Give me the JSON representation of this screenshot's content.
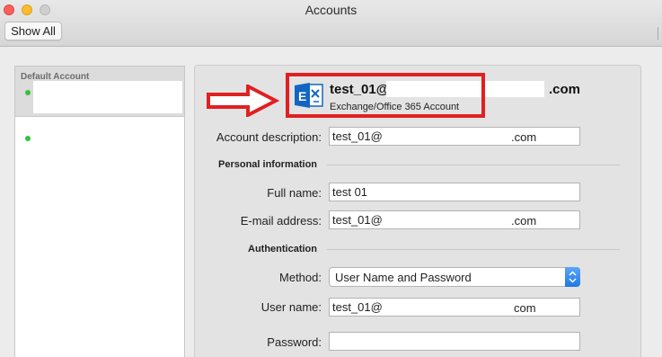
{
  "window": {
    "title": "Accounts",
    "show_all_label": "Show All"
  },
  "sidebar": {
    "default_label": "Default Account"
  },
  "account": {
    "name_prefix": "test_01@",
    "name_suffix": ".com",
    "type": "Exchange/Office 365 Account",
    "icon": "exchange-icon"
  },
  "form": {
    "description_label": "Account description:",
    "description_prefix": "test_01@",
    "description_suffix": ".com",
    "personal_section": "Personal information",
    "fullname_label": "Full name:",
    "fullname_value": "test 01",
    "email_label": "E-mail address:",
    "email_prefix": "test_01@",
    "email_suffix": ".com",
    "auth_section": "Authentication",
    "method_label": "Method:",
    "method_value": "User Name and Password",
    "username_label": "User name:",
    "username_prefix": "test_01@",
    "username_suffix": "com",
    "password_label": "Password:",
    "password_value": ""
  },
  "colors": {
    "highlight": "#e02021",
    "status_dot": "#36c23c",
    "exchange_blue": "#1266c2"
  }
}
